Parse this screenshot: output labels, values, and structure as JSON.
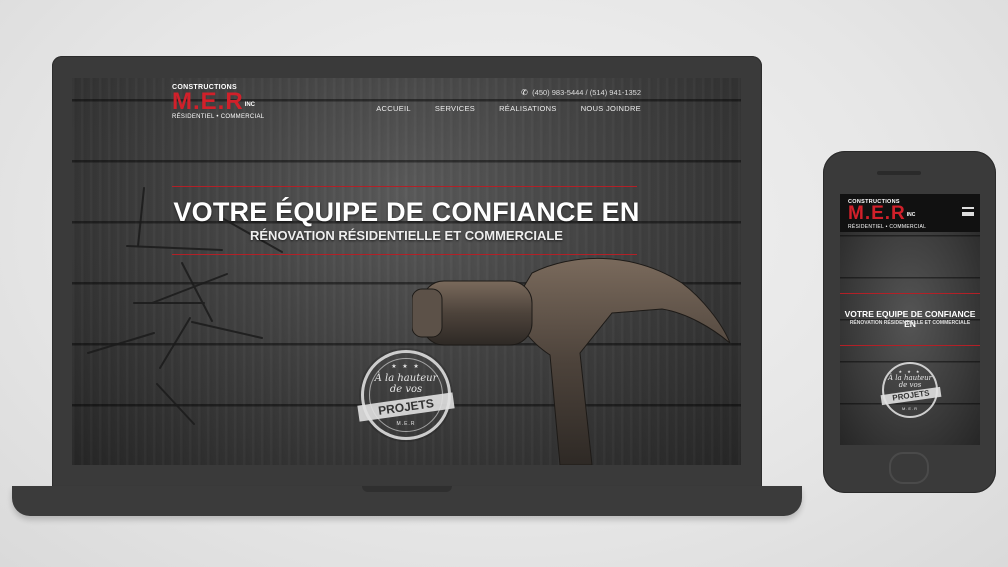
{
  "desktop": {
    "logo": {
      "top": "CONSTRUCTIONS",
      "main": "M.E.R",
      "inc": "INC",
      "sub": "RÉSIDENTIEL • COMMERCIAL"
    },
    "phone_text": "(450) 983-5444 / (514) 941-1352",
    "nav": [
      "ACCUEIL",
      "SERVICES",
      "RÉALISATIONS",
      "NOUS JOINDRE"
    ],
    "hero_title": "VOTRE ÉQUIPE DE CONFIANCE EN",
    "hero_subtitle": "RÉNOVATION RÉSIDENTIELLE ET COMMERCIALE",
    "badge": {
      "stars": "★ ★ ★",
      "script_line1": "À la hauteur",
      "script_line2": "de vos",
      "ribbon": "PROJETS",
      "foot": "M.E.R"
    }
  },
  "mobile": {
    "logo": {
      "top": "CONSTRUCTIONS",
      "main": "M.E.R",
      "inc": "INC",
      "sub": "RÉSIDENTIEL • COMMERCIAL"
    },
    "hero_title": "VOTRE EQUIPE DE CONFIANCE EN",
    "hero_subtitle": "RÉNOVATION RÉSIDENTIELLE ET COMMERCIALE",
    "badge": {
      "stars": "★ ★ ★",
      "script_line1": "À la hauteur",
      "script_line2": "de vos",
      "ribbon": "PROJETS",
      "foot": "M.E.R"
    }
  },
  "colors": {
    "brand_red": "#d1202a",
    "device_body": "#3a3a3a",
    "background": "#e6e6e6"
  },
  "icons": {
    "phone": "phone-icon",
    "menu": "hamburger-menu-icon"
  }
}
